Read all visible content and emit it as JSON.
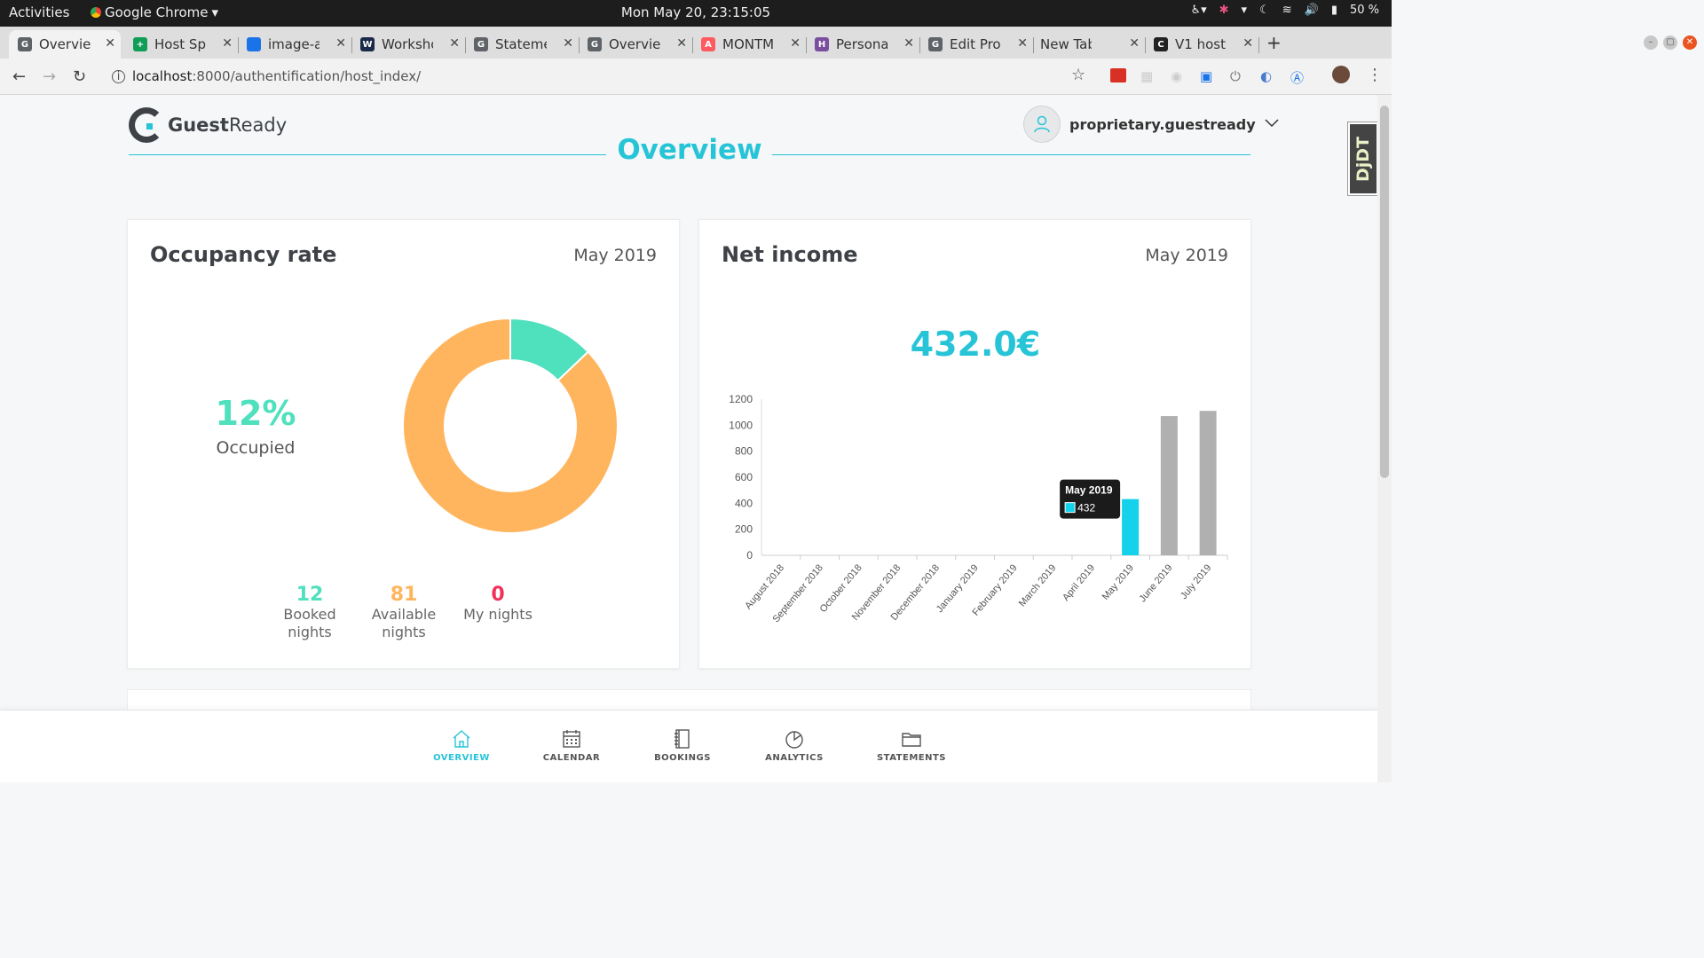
{
  "os": {
    "activities": "Activities",
    "app_name": "Google Chrome",
    "clock": "Mon May 20, 23:15:05",
    "battery": "50 %"
  },
  "browser": {
    "tabs": [
      {
        "label": "Overview",
        "color": "#5f6368",
        "glyph": "G"
      },
      {
        "label": "Host Space",
        "color": "#0f9d58",
        "glyph": "+"
      },
      {
        "label": "image-a",
        "color": "#1a73e8",
        "glyph": "ibb"
      },
      {
        "label": "Workshop",
        "color": "#1b2a4a",
        "glyph": "W"
      },
      {
        "label": "Statements",
        "color": "#5f6368",
        "glyph": "G"
      },
      {
        "label": "Overview",
        "color": "#5f6368",
        "glyph": "G"
      },
      {
        "label": "MONTM",
        "color": "#ff5a5f",
        "glyph": "A"
      },
      {
        "label": "Personal",
        "color": "#7b4fa0",
        "glyph": "H"
      },
      {
        "label": "Edit Pro",
        "color": "#5f6368",
        "glyph": "G"
      },
      {
        "label": "New Tab",
        "color": "",
        "glyph": ""
      },
      {
        "label": "V1 host",
        "color": "#222",
        "glyph": "C"
      }
    ],
    "url_prefix": "localhost",
    "url_rest": ":8000/authentification/host_index/"
  },
  "app": {
    "logo_bold": "Guest",
    "logo_rest": "Ready",
    "username": "proprietary.guestready",
    "page_title": "Overview",
    "ddt_badge": "DjDT"
  },
  "occupancy": {
    "title": "Occupancy rate",
    "date": "May 2019",
    "percent": "12%",
    "percent_label": "Occupied",
    "booked_value": "12",
    "booked_label": "Booked nights",
    "available_value": "81",
    "available_label": "Available nights",
    "my_value": "0",
    "my_label": "My nights",
    "colors": {
      "booked": "#4fe0bd",
      "available": "#ffb55e",
      "my": "#f0325a"
    }
  },
  "income": {
    "title": "Net income",
    "date": "May 2019",
    "total": "432.0€"
  },
  "chart_data": {
    "type": "bar",
    "categories": [
      "August 2018",
      "September 2018",
      "October 2018",
      "November 2018",
      "December 2018",
      "January 2019",
      "February 2019",
      "March 2019",
      "April 2019",
      "May 2019",
      "June 2019",
      "July 2019"
    ],
    "values": [
      0,
      0,
      0,
      0,
      0,
      0,
      0,
      0,
      0,
      432,
      1070,
      1110
    ],
    "highlight_index": 9,
    "highlight_color": "#14d1ec",
    "bar_color": "#b0b0b0",
    "ylim": [
      0,
      1200
    ],
    "yticks": [
      "0",
      "200",
      "400",
      "600",
      "800",
      "1000",
      "1200"
    ],
    "tooltip_title": "May 2019",
    "tooltip_value": "432"
  },
  "bottom_nav": [
    {
      "label": "OVERVIEW",
      "icon": "home-icon",
      "active": true
    },
    {
      "label": "CALENDAR",
      "icon": "calendar-icon",
      "active": false
    },
    {
      "label": "BOOKINGS",
      "icon": "book-icon",
      "active": false
    },
    {
      "label": "ANALYTICS",
      "icon": "pie-chart-icon",
      "active": false
    },
    {
      "label": "STATEMENTS",
      "icon": "folder-icon",
      "active": false
    }
  ]
}
